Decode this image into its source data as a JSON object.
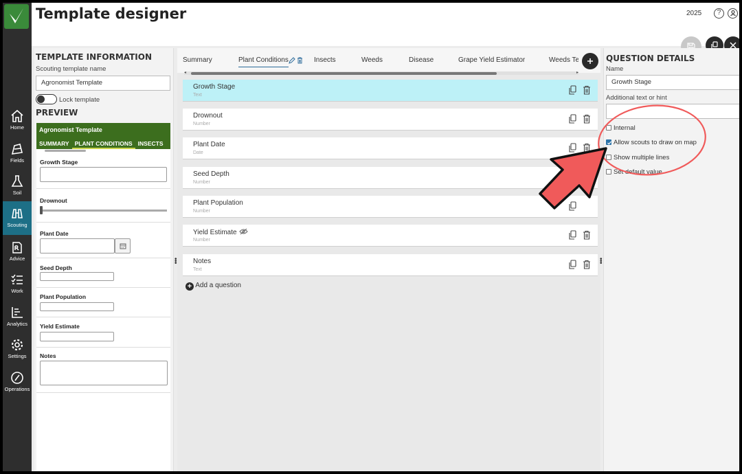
{
  "header": {
    "title": "Template designer",
    "year": "2025"
  },
  "nav": [
    {
      "label": "Home",
      "icon": "home-icon"
    },
    {
      "label": "Fields",
      "icon": "fields-icon"
    },
    {
      "label": "Soil",
      "icon": "soil-icon"
    },
    {
      "label": "Scouting",
      "icon": "binoculars-icon",
      "active": true
    },
    {
      "label": "Advice",
      "icon": "advice-icon"
    },
    {
      "label": "Work",
      "icon": "work-icon"
    },
    {
      "label": "Analytics",
      "icon": "analytics-icon"
    },
    {
      "label": "Settings",
      "icon": "gear-icon"
    },
    {
      "label": "Operations",
      "icon": "operations-icon"
    }
  ],
  "template_info": {
    "heading": "TEMPLATE INFORMATION",
    "name_label": "Scouting template name",
    "name_value": "Agronomist Template",
    "lock_label": "Lock template",
    "lock_on": false
  },
  "preview": {
    "heading": "PREVIEW",
    "title": "Agronomist Template",
    "tabs": [
      "SUMMARY",
      "PLANT CONDITIONS",
      "INSECTS"
    ],
    "selected_tab": "PLANT CONDITIONS",
    "fields": [
      {
        "label": "Growth Stage"
      },
      {
        "label": "Drownout"
      },
      {
        "label": "Plant Date"
      },
      {
        "label": "Seed Depth"
      },
      {
        "label": "Plant Population"
      },
      {
        "label": "Yield Estimate"
      },
      {
        "label": "Notes"
      }
    ]
  },
  "tabs": [
    "Summary",
    "Plant Conditions",
    "Insects",
    "Weeds",
    "Disease",
    "Grape Yield Estimator",
    "Weeds Te"
  ],
  "selected_tab": "Plant Conditions",
  "questions": [
    {
      "title": "Growth Stage",
      "type": "Text",
      "selected": true
    },
    {
      "title": "Drownout",
      "type": "Number"
    },
    {
      "title": "Plant Date",
      "type": "Date"
    },
    {
      "title": "Seed Depth",
      "type": "Number"
    },
    {
      "title": "Plant Population",
      "type": "Number"
    },
    {
      "title": "Yield Estimate",
      "type": "Number",
      "hidden": true
    },
    {
      "title": "Notes",
      "type": "Text"
    }
  ],
  "add_question": "Add a question",
  "details": {
    "heading": "QUESTION DETAILS",
    "name_label": "Name",
    "name_value": "Growth Stage",
    "hint_label": "Additional text or hint",
    "hint_value": "",
    "options": [
      {
        "label": "Internal",
        "checked": false
      },
      {
        "label": "Allow scouts to draw on map",
        "checked": true
      },
      {
        "label": "Show multiple lines",
        "checked": false
      },
      {
        "label": "Set default value",
        "checked": false
      }
    ]
  },
  "colors": {
    "accent": "#1d6f86",
    "brand_green": "#3c6e1e",
    "selected_card": "#bdf1f7",
    "annotation": "#f05a5a"
  }
}
